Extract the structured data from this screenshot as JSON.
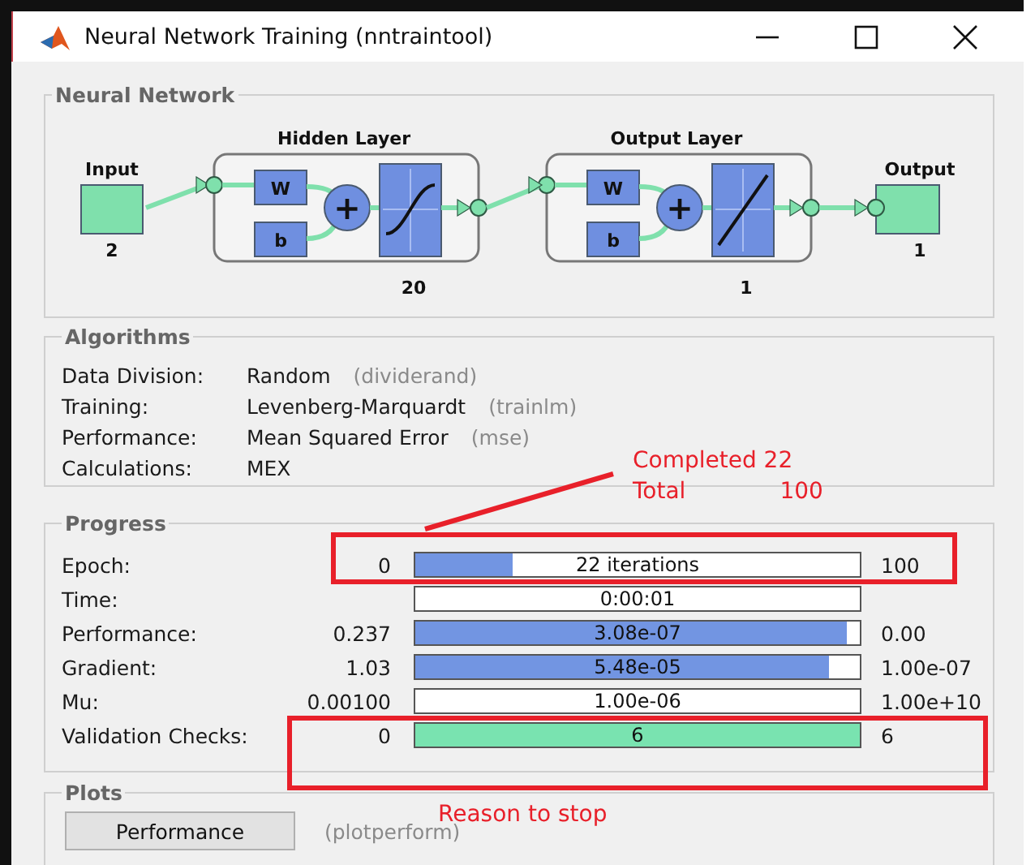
{
  "window": {
    "title": "Neural Network Training (nntraintool)"
  },
  "network": {
    "title": "Neural Network",
    "input": {
      "label": "Input",
      "size": "2"
    },
    "layers": [
      {
        "title": "Hidden Layer",
        "weight": "W",
        "bias": "b",
        "sum": "+",
        "kind": "sigmoid",
        "size": "20"
      },
      {
        "title": "Output Layer",
        "weight": "W",
        "bias": "b",
        "sum": "+",
        "kind": "linear",
        "size": "1"
      }
    ],
    "output": {
      "label": "Output",
      "size": "1"
    }
  },
  "algorithms": {
    "title": "Algorithms",
    "rows": [
      {
        "label": "Data Division:",
        "value": "Random",
        "function": "(dividerand)"
      },
      {
        "label": "Training:",
        "value": "Levenberg-Marquardt",
        "function": "(trainlm)"
      },
      {
        "label": "Performance:",
        "value": "Mean Squared Error",
        "function": "(mse)"
      },
      {
        "label": "Calculations:",
        "value": "MEX"
      }
    ]
  },
  "progress": {
    "title": "Progress",
    "rows": [
      {
        "label": "Epoch:",
        "start": "0",
        "bar_text": "22 iterations",
        "level": 0.22,
        "end": "100",
        "kind": "measure"
      },
      {
        "label": "Time:",
        "bar_text": "0:00:01",
        "level": 0,
        "kind": "measure"
      },
      {
        "label": "Performance:",
        "start": "0.237",
        "bar_text": "3.08e-07",
        "level": 0.97,
        "end": "0.00",
        "kind": "measure"
      },
      {
        "label": "Gradient:",
        "start": "1.03",
        "bar_text": "5.48e-05",
        "level": 0.93,
        "end": "1.00e-07",
        "kind": "measure"
      },
      {
        "label": "Mu:",
        "start": "0.00100",
        "bar_text": "1.00e-06",
        "level": 0,
        "end": "1.00e+10",
        "kind": "measure"
      },
      {
        "label": "Validation Checks:",
        "start": "0",
        "bar_text": "6",
        "level": 1,
        "end": "6",
        "kind": "check"
      }
    ]
  },
  "plots": {
    "title": "Plots",
    "buttons": [
      {
        "label": "Performance",
        "function": "(plotperform)"
      }
    ]
  },
  "annotations": {
    "epoch_note": {
      "lines": [
        {
          "text": "Completed 22"
        },
        {
          "text": "Total",
          "value": "100"
        }
      ]
    },
    "stop_note": {
      "text": "Reason to stop"
    }
  }
}
